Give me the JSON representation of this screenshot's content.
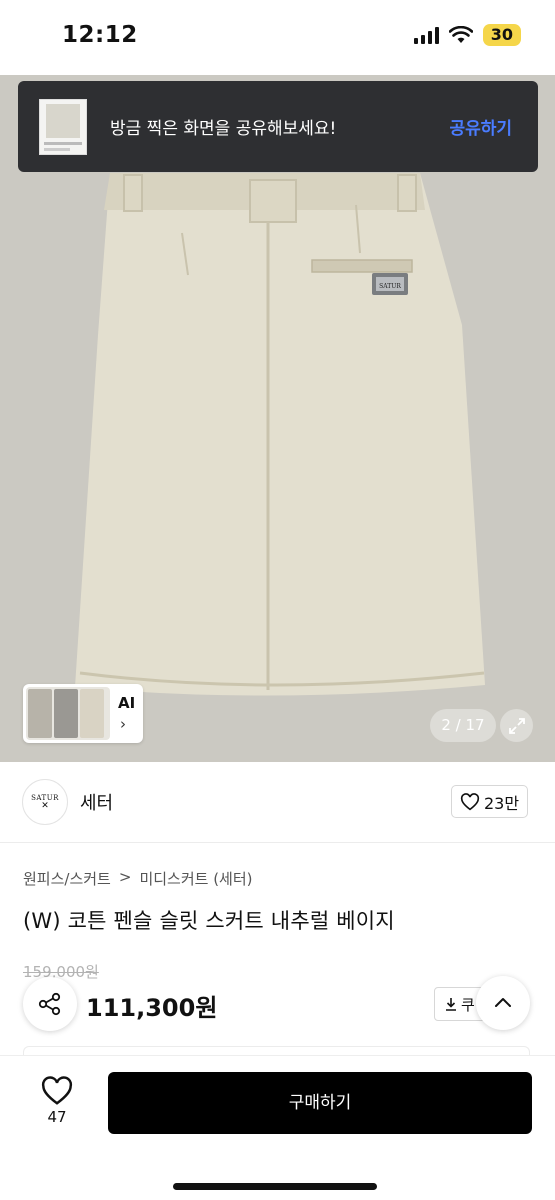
{
  "status_bar": {
    "time": "12:12",
    "battery": "30"
  },
  "toast": {
    "message": "방금 찍은 화면을 공유해보세요!",
    "action": "공유하기"
  },
  "gallery": {
    "ai_label": "AI",
    "ai_chevron": "›",
    "counter": "2 / 17",
    "patch_text": "SATUR"
  },
  "brand": {
    "logo_text": "SATUR",
    "logo_mark": "✕",
    "name": "세터",
    "likes": "23만"
  },
  "product": {
    "breadcrumb": [
      "원피스/스커트",
      "미디스커트 (세터)"
    ],
    "breadcrumb_sep": ">",
    "title": "(W) 코튼 펜슬 슬릿 스커트 내추럴 베이지",
    "original_price": "159,000원",
    "price": "111,300원",
    "coupon_label": "쿠"
  },
  "bottom_bar": {
    "wish_count": "47",
    "buy_label": "구매하기"
  },
  "icons": [
    "signal-icon",
    "wifi-icon",
    "share-icon",
    "heart-icon",
    "download-icon",
    "chevron-up-icon",
    "expand-icon"
  ]
}
